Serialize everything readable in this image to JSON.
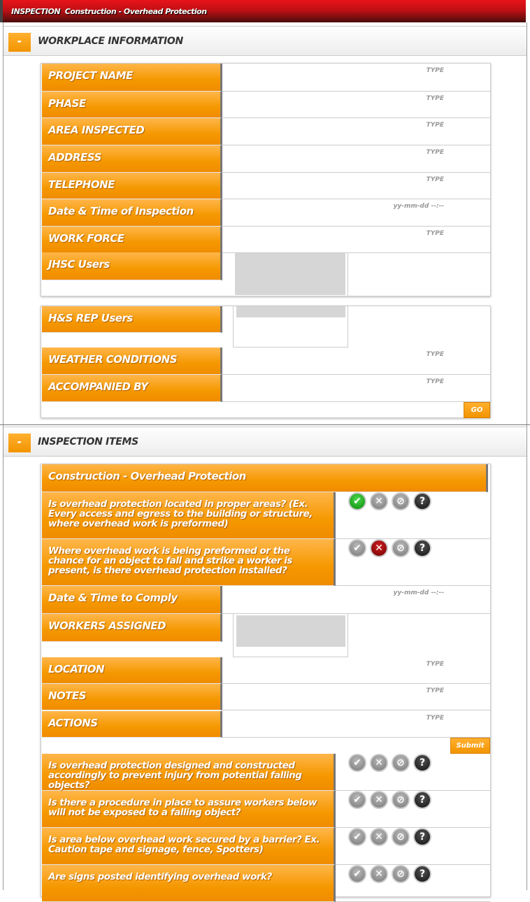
{
  "header": {
    "label": "INSPECTION",
    "title": "Construction - Overhead Protection"
  },
  "workplace": {
    "title": "WORKPLACE INFORMATION",
    "toggle": "-",
    "fields": [
      {
        "label": "PROJECT NAME",
        "placeholder": "TYPE"
      },
      {
        "label": "PHASE",
        "placeholder": "TYPE"
      },
      {
        "label": "AREA INSPECTED",
        "placeholder": "TYPE"
      },
      {
        "label": "ADDRESS",
        "placeholder": "TYPE"
      },
      {
        "label": "TELEPHONE",
        "placeholder": "TYPE"
      },
      {
        "label": "Date & Time of Inspection",
        "placeholder": "yy-mm-dd --:--"
      },
      {
        "label": "WORK FORCE",
        "placeholder": "TYPE"
      }
    ],
    "jhsc_label": "JHSC Users",
    "hs_label": "H&S REP Users",
    "fields2": [
      {
        "label": "WEATHER CONDITIONS",
        "placeholder": "TYPE"
      },
      {
        "label": "ACCOMPANIED BY",
        "placeholder": "TYPE"
      }
    ],
    "go": "GO"
  },
  "items": {
    "title": "INSPECTION ITEMS",
    "toggle": "-",
    "group": "Construction - Overhead Protection",
    "questions": [
      {
        "text": "Is overhead protection located in proper areas? (Ex. Every access and egress to the building or structure, where overhead work is preformed)",
        "status": "yes"
      },
      {
        "text": "Where overhead work is being preformed or the chance for an object to fall and strike a worker is present, is there overhead protection installed?",
        "status": "no"
      },
      {
        "text": "Is overhead protection designed and constructed accordingly to prevent injury from potential falling objects?",
        "status": "none"
      },
      {
        "text": "Is there a procedure in place to assure workers below will not be exposed to a falling object?",
        "status": "none"
      },
      {
        "text": "Is area below overhead work secured by a barrier? Ex. Caution tape and signage, fence, Spotters)",
        "status": "none"
      },
      {
        "text": "Are signs posted identifying overhead work?",
        "status": "none"
      }
    ],
    "comply_label": "Date & Time to Comply",
    "comply_placeholder": "yy-mm-dd --:--",
    "workers_label": "WORKERS ASSIGNED",
    "fields": [
      {
        "label": "LOCATION",
        "placeholder": "TYPE"
      },
      {
        "label": "NOTES",
        "placeholder": "TYPE"
      },
      {
        "label": "ACTIONS",
        "placeholder": "TYPE"
      }
    ],
    "submit": "Submit"
  },
  "colors": {
    "orange": "#f59800",
    "red": "#e8141a",
    "yes": "#0a8a0a",
    "no": "#a00000"
  }
}
